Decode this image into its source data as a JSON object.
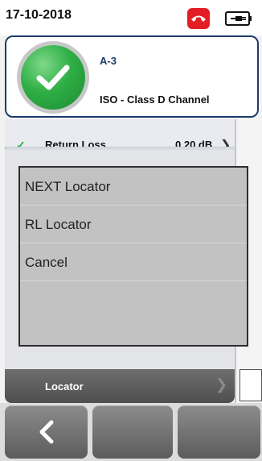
{
  "status_bar": {
    "date": "17-10-2018",
    "phone_icon": "phone-hangup-icon",
    "battery_icon": "battery-plug-icon"
  },
  "result_card": {
    "status_icon": "check-circle-icon",
    "title": "A-3",
    "subtitle": "ISO - Class D Channel",
    "border_color": "#1d3c6b",
    "status_color": "#2eaf45"
  },
  "background_list": {
    "row_label": "Return Loss",
    "row_value": "0.20 dB"
  },
  "dialog": {
    "items": [
      {
        "label": "NEXT Locator"
      },
      {
        "label": "RL Locator"
      },
      {
        "label": "Cancel"
      }
    ]
  },
  "locator_row": {
    "label": "Locator"
  },
  "softkeys": {
    "back_icon": "chevron-left-icon"
  }
}
